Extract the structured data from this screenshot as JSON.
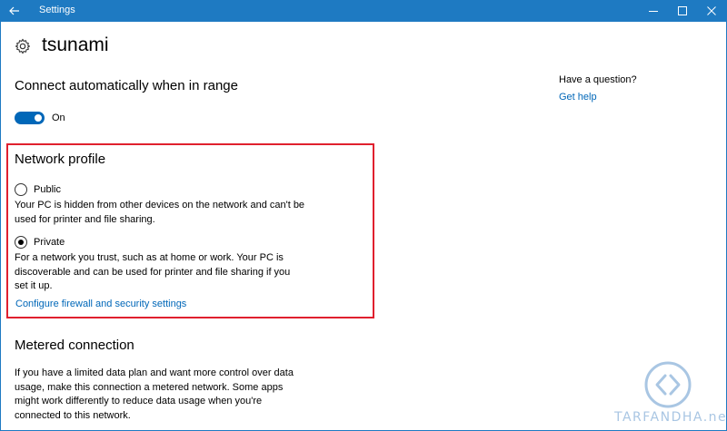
{
  "window": {
    "title": "Settings",
    "back_icon": "back-arrow-icon",
    "controls": [
      "minimize-icon",
      "maximize-icon",
      "close-icon"
    ],
    "accent_color": "#1e7ac2"
  },
  "header": {
    "icon": "gear-icon",
    "title": "tsunami"
  },
  "auto_connect": {
    "heading": "Connect automatically when in range",
    "toggle_state": "On",
    "toggle_on": true
  },
  "network_profile": {
    "heading": "Network profile",
    "options": [
      {
        "label": "Public",
        "checked": false,
        "description": "Your PC is hidden from other devices on the network and can't be used for printer and file sharing."
      },
      {
        "label": "Private",
        "checked": true,
        "description": "For a network you trust, such as at home or work. Your PC is discoverable and can be used for printer and file sharing if you set it up."
      }
    ],
    "firewall_link": "Configure firewall and security settings",
    "highlight_color": "#e0202e"
  },
  "metered": {
    "heading": "Metered connection",
    "description": "If you have a limited data plan and want more control over data usage, make this connection a metered network. Some apps might work differently to reduce data usage when you're connected to this network."
  },
  "aside": {
    "question": "Have a question?",
    "help_link": "Get help"
  },
  "watermark": {
    "text": "TARFANDHA.net",
    "logo_icon": "tarfandha-logo-icon"
  }
}
